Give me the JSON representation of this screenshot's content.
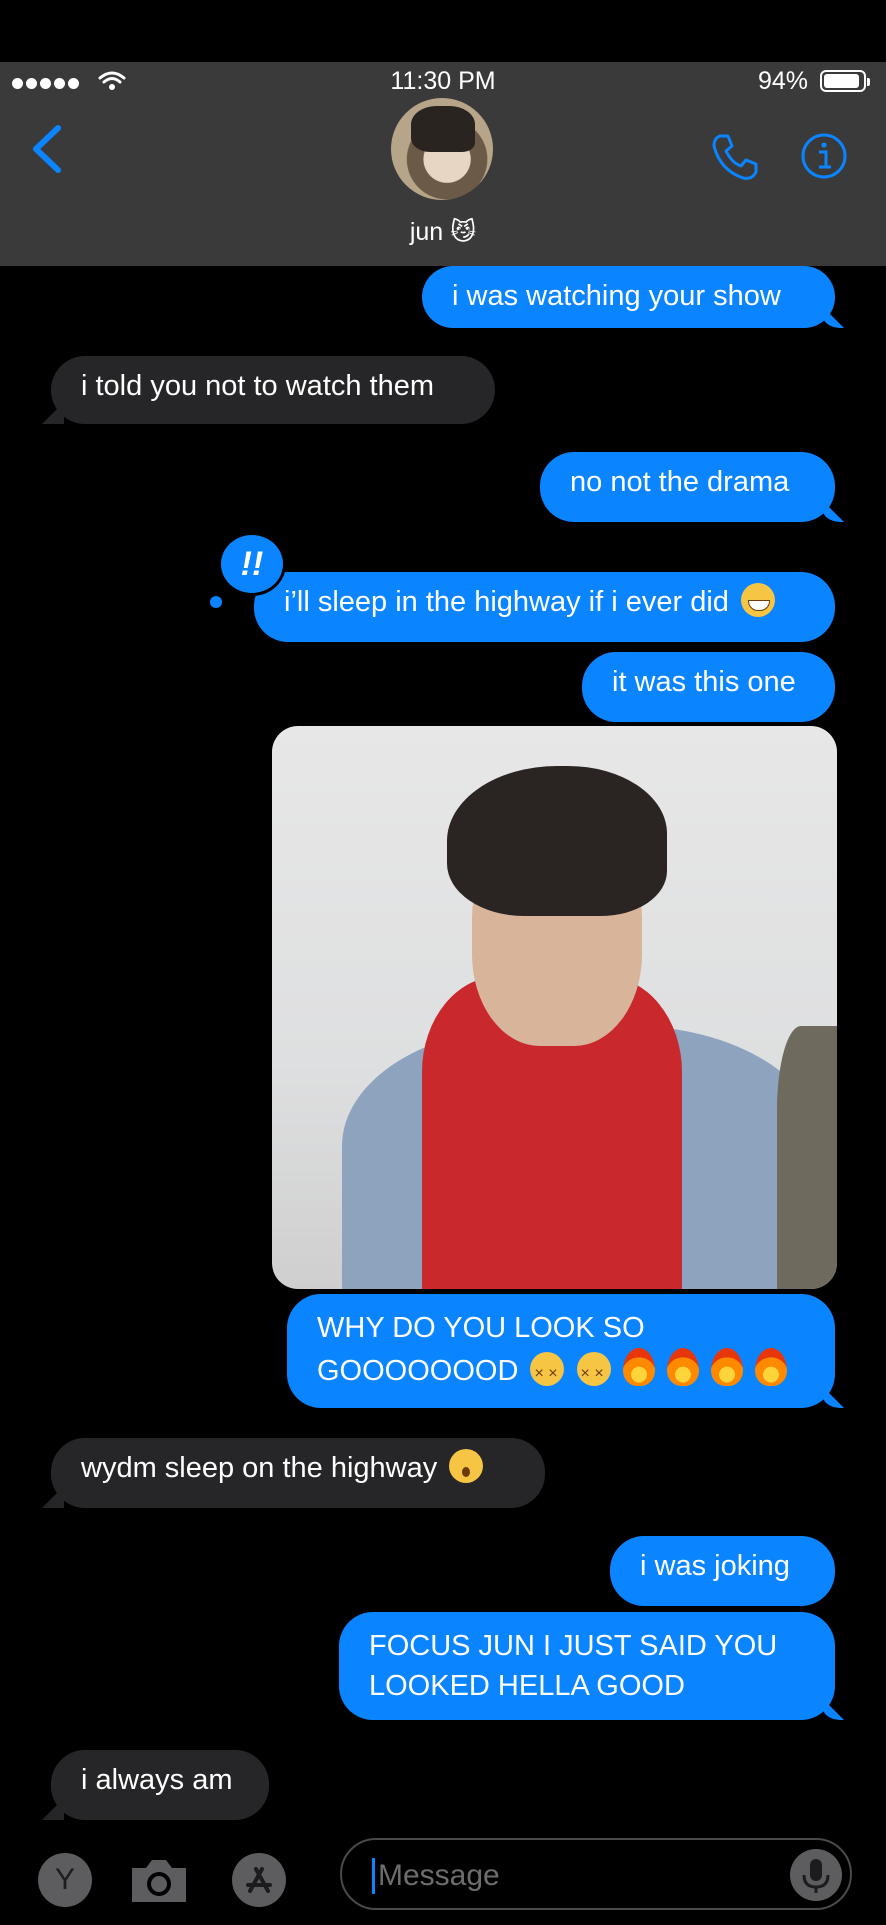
{
  "status_bar": {
    "time": "11:30 PM",
    "battery": "94%",
    "battery_level": 0.94
  },
  "header": {
    "contact_name": "jun 😼"
  },
  "messages": [
    {
      "from": "me",
      "text": "i was watching your show"
    },
    {
      "from": "them",
      "text": "i told you not to watch them"
    },
    {
      "from": "me",
      "text": "no not the drama"
    },
    {
      "from": "me",
      "text": "i’ll sleep in the highway if i ever did",
      "emoji": "grinning",
      "reaction": "!!"
    },
    {
      "from": "me",
      "text": "it was this one"
    },
    {
      "from": "me",
      "type": "photo"
    },
    {
      "from": "me",
      "line1": "WHY DO YOU LOOK SO",
      "line2": "GOOOOOOOD",
      "emojis": [
        "tired",
        "tired",
        "fire",
        "fire",
        "fire",
        "fire"
      ]
    },
    {
      "from": "them",
      "text": "wydm sleep on the highway",
      "emoji": "surprised"
    },
    {
      "from": "me",
      "text": "i was joking"
    },
    {
      "from": "me",
      "line1": "FOCUS JUN I JUST SAID YOU",
      "line2": "LOOKED HELLA GOOD"
    },
    {
      "from": "them",
      "text": "i always am"
    }
  ],
  "input_bar": {
    "app_letter": "Y",
    "placeholder": "Message"
  },
  "colors": {
    "sent": "#0a84ff",
    "received": "#262628",
    "header": "#3a3a3a",
    "accent": "#0a84ff"
  },
  "icons": [
    "signal-dots-icon",
    "wifi-icon",
    "battery-icon",
    "back-chevron-icon",
    "phone-icon",
    "info-icon",
    "camera-icon",
    "app-store-icon",
    "microphone-icon"
  ]
}
